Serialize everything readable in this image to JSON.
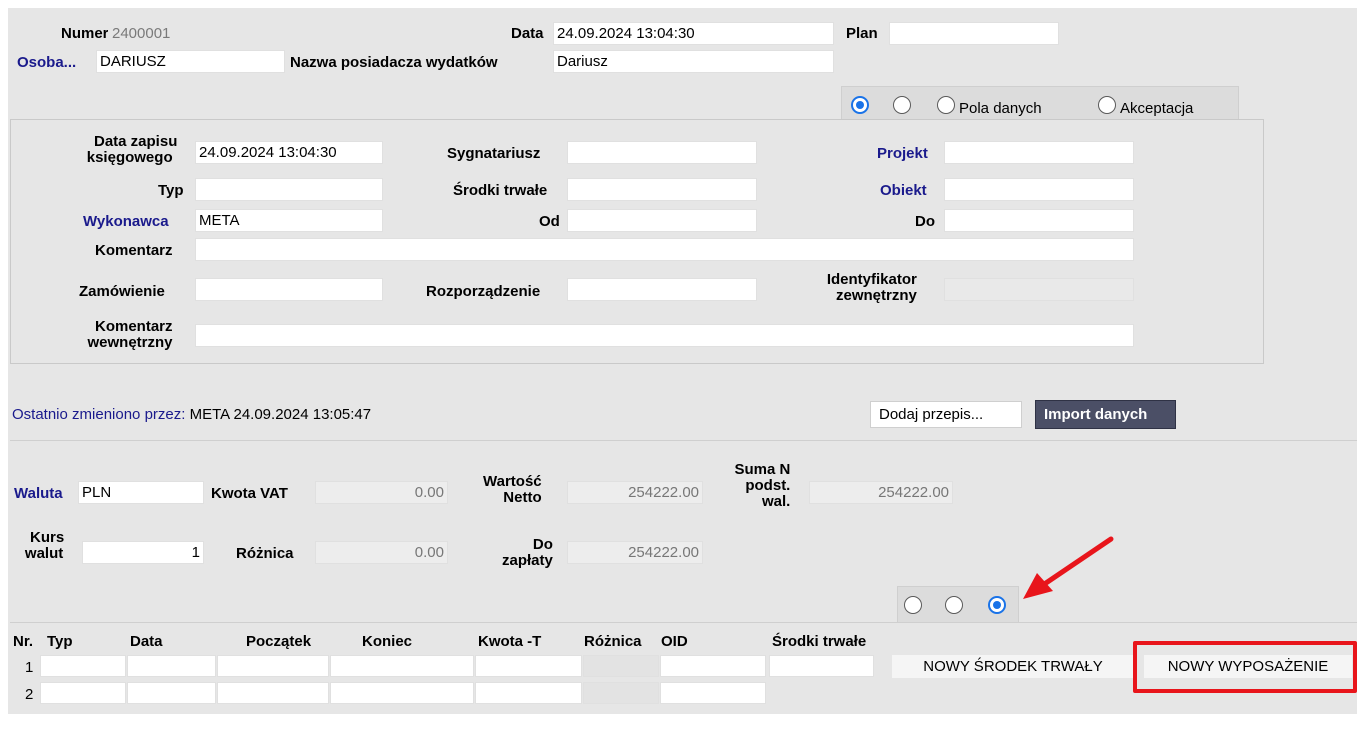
{
  "header": {
    "numer_label": "Numer",
    "numer_value": "2400001",
    "data_label": "Data",
    "data_value": "24.09.2024 13:04:30",
    "plan_label": "Plan",
    "plan_value": "",
    "osoba_label": "Osoba...",
    "osoba_value": "DARIUSZ",
    "nazwa_label": "Nazwa posiadacza wydatków",
    "nazwa_value": "Dariusz"
  },
  "tabs": {
    "pola_danych": "Pola danych",
    "akceptacja": "Akceptacja"
  },
  "details": {
    "data_zapisu_label_1": "Data zapisu",
    "data_zapisu_label_2": "księgowego",
    "data_zapisu_value": "24.09.2024 13:04:30",
    "sygnatariusz_label": "Sygnatariusz",
    "projekt_label": "Projekt",
    "typ_label": "Typ",
    "srodki_trwale_label": "Środki trwałe",
    "obiekt_label": "Obiekt",
    "wykonawca_label": "Wykonawca",
    "wykonawca_value": "META",
    "od_label": "Od",
    "do_label": "Do",
    "komentarz_label": "Komentarz",
    "zamowienie_label": "Zamówienie",
    "rozporzadzenie_label": "Rozporządzenie",
    "identyfikator_label_1": "Identyfikator",
    "identyfikator_label_2": "zewnętrzny",
    "komentarz_wew_label_1": "Komentarz",
    "komentarz_wew_label_2": "wewnętrzny"
  },
  "status": {
    "changed_label": "Ostatnio zmieniono przez:",
    "changed_value": " META 24.09.2024 13:05:47",
    "dodaj_przepis": "Dodaj przepis...",
    "import_danych": "Import danych"
  },
  "totals": {
    "waluta_label": "Waluta",
    "waluta_value": "PLN",
    "kwota_vat_label": "Kwota VAT",
    "kwota_vat_value": "0.00",
    "wartosc_netto_label_1": "Wartość",
    "wartosc_netto_label_2": "Netto",
    "wartosc_netto_value": "254222.00",
    "suma_label_1": "Suma N",
    "suma_label_2": "podst.",
    "suma_label_3": "wal.",
    "suma_value": "254222.00",
    "kurs_label_1": "Kurs",
    "kurs_label_2": "walut",
    "kurs_value": "1",
    "roznica_label": "Różnica",
    "roznica_value": "0.00",
    "do_zaplaty_label_1": "Do",
    "do_zaplaty_label_2": "zapłaty",
    "do_zaplaty_value": "254222.00"
  },
  "table": {
    "headers": {
      "nr": "Nr.",
      "typ": "Typ",
      "data": "Data",
      "poczatek": "Początek",
      "koniec": "Koniec",
      "kwota": "Kwota -T",
      "roznica": "Różnica",
      "oid": "OID",
      "srodki": "Środki trwałe"
    },
    "rows": [
      {
        "nr": "1"
      },
      {
        "nr": "2"
      }
    ],
    "nowy_srodek": "NOWY ŚRODEK TRWAŁY",
    "nowy_wyposazenie": "NOWY WYPOSAŻENIE"
  },
  "colors": {
    "accent_blue": "#1a73e8",
    "label_blue": "#1a1a8c",
    "highlight_red": "#e8151b",
    "import_button": "#4b4f66"
  }
}
